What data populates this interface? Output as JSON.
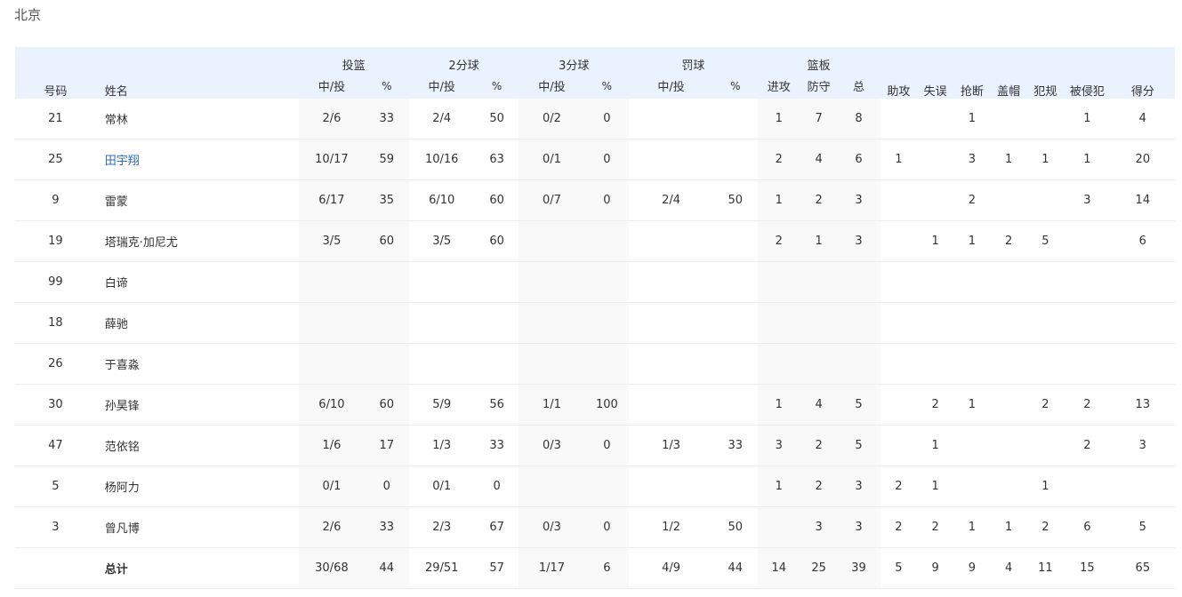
{
  "team": "北京",
  "header": {
    "number": "号码",
    "name": "姓名",
    "fg": "投篮",
    "two": "2分球",
    "three": "3分球",
    "ft": "罚球",
    "reb": "篮板",
    "made_att": "中/投",
    "pct": "%",
    "off": "进攻",
    "def": "防守",
    "tot": "总",
    "ast": "助攻",
    "tov": "失误",
    "stl": "抢断",
    "blk": "盖帽",
    "pf": "犯规",
    "fd": "被侵犯",
    "pts": "得分"
  },
  "link_color": "#2d6bc4",
  "rows": [
    [
      "21",
      "常林",
      "2/6",
      "33",
      "2/4",
      "50",
      "0/2",
      "0",
      "",
      "",
      "1",
      "7",
      "8",
      "",
      "",
      "1",
      "",
      "",
      "1",
      "4"
    ],
    [
      "25",
      "田宇翔",
      "10/17",
      "59",
      "10/16",
      "63",
      "0/1",
      "0",
      "",
      "",
      "2",
      "4",
      "6",
      "1",
      "",
      "3",
      "1",
      "1",
      "1",
      "20"
    ],
    [
      "9",
      "雷蒙",
      "6/17",
      "35",
      "6/10",
      "60",
      "0/7",
      "0",
      "2/4",
      "50",
      "1",
      "2",
      "3",
      "",
      "",
      "2",
      "",
      "",
      "3",
      "14"
    ],
    [
      "19",
      "塔瑞克·加尼尤",
      "3/5",
      "60",
      "3/5",
      "60",
      "",
      "",
      "",
      "",
      "2",
      "1",
      "3",
      "",
      "1",
      "1",
      "2",
      "5",
      "",
      "6"
    ],
    [
      "99",
      "白谛",
      "",
      "",
      "",
      "",
      "",
      "",
      "",
      "",
      "",
      "",
      "",
      "",
      "",
      "",
      "",
      "",
      "",
      ""
    ],
    [
      "18",
      "薛驰",
      "",
      "",
      "",
      "",
      "",
      "",
      "",
      "",
      "",
      "",
      "",
      "",
      "",
      "",
      "",
      "",
      "",
      ""
    ],
    [
      "26",
      "于喜淼",
      "",
      "",
      "",
      "",
      "",
      "",
      "",
      "",
      "",
      "",
      "",
      "",
      "",
      "",
      "",
      "",
      "",
      ""
    ],
    [
      "30",
      "孙昊锋",
      "6/10",
      "60",
      "5/9",
      "56",
      "1/1",
      "100",
      "",
      "",
      "1",
      "4",
      "5",
      "",
      "2",
      "1",
      "",
      "2",
      "2",
      "13"
    ],
    [
      "47",
      "范依铭",
      "1/6",
      "17",
      "1/3",
      "33",
      "0/3",
      "0",
      "1/3",
      "33",
      "3",
      "2",
      "5",
      "",
      "1",
      "",
      "",
      "",
      "2",
      "3"
    ],
    [
      "5",
      "杨阿力",
      "0/1",
      "0",
      "0/1",
      "0",
      "",
      "",
      "",
      "",
      "1",
      "2",
      "3",
      "2",
      "1",
      "",
      "",
      "1",
      "",
      ""
    ],
    [
      "3",
      "曾凡博",
      "2/6",
      "33",
      "2/3",
      "67",
      "0/3",
      "0",
      "1/2",
      "50",
      "",
      "3",
      "3",
      "2",
      "2",
      "1",
      "1",
      "2",
      "6",
      "5"
    ],
    [
      "",
      "总计",
      "30/68",
      "44",
      "29/51",
      "57",
      "1/17",
      "6",
      "4/9",
      "44",
      "14",
      "25",
      "39",
      "5",
      "9",
      "9",
      "4",
      "11",
      "15",
      "65"
    ]
  ],
  "linked_row": 1,
  "total_row": 11
}
